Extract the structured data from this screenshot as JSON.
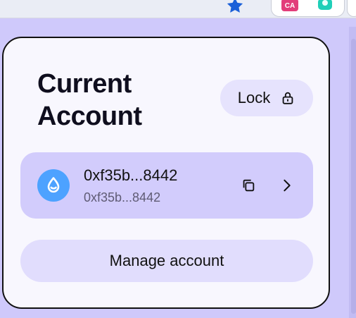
{
  "browser": {
    "extensions": {
      "ca_badge": "CA"
    },
    "icons": {
      "bookmark": "star-icon",
      "ca_extension": "ca-extension-icon",
      "green_extension": "extension-icon"
    }
  },
  "panel": {
    "title": "Current Account",
    "lock_button": {
      "label": "Lock",
      "icon": "lock-icon"
    },
    "account": {
      "address_primary": "0xf35b...8442",
      "address_secondary": "0xf35b...8442",
      "avatar_icon": "sui-droplet-icon",
      "copy_icon": "copy-icon",
      "chevron_icon": "chevron-right-icon"
    },
    "manage_button": {
      "label": "Manage account"
    }
  },
  "colors": {
    "page_background": "#cfc9fb",
    "card_background": "#f8f7fe",
    "account_row": "#d2ccfc",
    "button_background": "#e1ddfd",
    "avatar": "#4da2ff",
    "bookmark_star": "#1a5fd8",
    "ca_badge": "#e23d7a",
    "green_extension": "#1fcfb8"
  }
}
